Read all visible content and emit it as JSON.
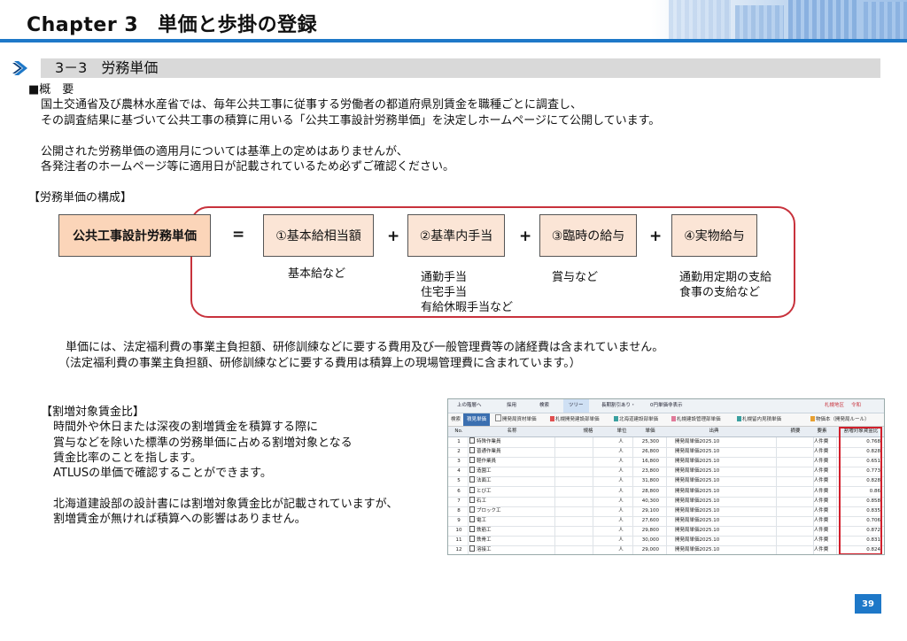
{
  "header": {
    "chapter": "Chapter 3",
    "title": "単価と歩掛の登録",
    "accent_color": "#1e78c8"
  },
  "section": {
    "title": "3－3　労務単価"
  },
  "overview": {
    "heading": "■概　要",
    "lines": [
      "国土交通省及び農林水産省では、毎年公共工事に従事する労働者の都道府県別賃金を職種ごとに調査し、",
      "その調査結果に基づいて公共工事の積算に用いる「公共工事設計労務単価」を決定しホームページにて公開しています。",
      "公開された労務単価の適用月については基準上の定めはありませんが、",
      "各発注者のホームページ等に適用日が記載されているため必ずご確認ください。"
    ]
  },
  "composition": {
    "heading": "【労務単価の構成】",
    "main_box": "公共工事設計労務単価",
    "equals": "=",
    "plus": "+",
    "boxes": [
      "①基本給相当額",
      "②基準内手当",
      "③臨時の給与",
      "④実物給与"
    ],
    "notes": {
      "b1": [
        "基本給など"
      ],
      "b2": [
        "通勤手当",
        "住宅手当",
        "有給休暇手当など"
      ],
      "b3": [
        "賞与など"
      ],
      "b4": [
        "通勤用定期の支給",
        "食事の支給など"
      ]
    },
    "footnote": [
      "単価には、法定福利費の事業主負担額、研修訓練などに要する費用及び一般管理費等の諸経費は含まれていません。",
      "（法定福利費の事業主負担額、研修訓練などに要する費用は積算上の現場管理費に含まれています。）"
    ]
  },
  "ratio": {
    "heading": "【割増対象賃金比】",
    "lines": [
      "時間外や休日または深夜の割増賃金を積算する際に",
      "賞与などを除いた標準の労務単価に占める割増対象となる",
      "賃金比率のことを指します。",
      "ATLUSの単価で確認することができます。",
      "北海道建設部の設計書には割増対象賃金比が記載されていますが、",
      "割増賃金が無ければ積算への影響はありません。"
    ]
  },
  "screenshot": {
    "toolbar": [
      "上の階層へ",
      "採用",
      "検索",
      "ツリー",
      "長期割引あり・",
      "0円単価非表示"
    ],
    "region": "札幌地区",
    "year": "令和",
    "tabs": [
      "検索",
      "積見単価",
      "開発局資材単価",
      "札幌開発建設部単価",
      "北海道建設部単価",
      "札幌建設管理部単価",
      "札幌留内見積単価",
      "物価本（開発局ルール）"
    ],
    "columns": [
      "No.",
      "名称",
      "規格",
      "単位",
      "単価",
      "出典",
      "摘要",
      "要素",
      "割増対象賃金比"
    ],
    "rows": [
      {
        "no": "1",
        "name": "特殊作業員",
        "unit": "人",
        "price": "25,300",
        "src": "開発局単価2025.10",
        "elem": "人件費",
        "ratio": "0.768"
      },
      {
        "no": "2",
        "name": "普通作業員",
        "unit": "人",
        "price": "26,800",
        "src": "開発局単価2025.10",
        "elem": "人件費",
        "ratio": "0.828"
      },
      {
        "no": "3",
        "name": "軽作業員",
        "unit": "人",
        "price": "16,800",
        "src": "開発局単価2025.10",
        "elem": "人件費",
        "ratio": "0.651"
      },
      {
        "no": "4",
        "name": "造園工",
        "unit": "人",
        "price": "23,800",
        "src": "開発局単価2025.10",
        "elem": "人件費",
        "ratio": "0.773"
      },
      {
        "no": "5",
        "name": "法面工",
        "unit": "人",
        "price": "31,800",
        "src": "開発局単価2025.10",
        "elem": "人件費",
        "ratio": "0.828"
      },
      {
        "no": "6",
        "name": "とび工",
        "unit": "人",
        "price": "28,800",
        "src": "開発局単価2025.10",
        "elem": "人件費",
        "ratio": "0.86"
      },
      {
        "no": "7",
        "name": "石工",
        "unit": "人",
        "price": "40,300",
        "src": "開発局単価2025.10",
        "elem": "人件費",
        "ratio": "0.858"
      },
      {
        "no": "8",
        "name": "ブロック工",
        "unit": "人",
        "price": "29,100",
        "src": "開発局単価2025.10",
        "elem": "人件費",
        "ratio": "0.835"
      },
      {
        "no": "9",
        "name": "電工",
        "unit": "人",
        "price": "27,600",
        "src": "開発局単価2025.10",
        "elem": "人件費",
        "ratio": "0.706"
      },
      {
        "no": "10",
        "name": "鉄筋工",
        "unit": "人",
        "price": "29,800",
        "src": "開発局単価2025.10",
        "elem": "人件費",
        "ratio": "0.872"
      },
      {
        "no": "11",
        "name": "鉄骨工",
        "unit": "人",
        "price": "30,000",
        "src": "開発局単価2025.10",
        "elem": "人件費",
        "ratio": "0.831"
      },
      {
        "no": "12",
        "name": "溶接工",
        "unit": "人",
        "price": "29,000",
        "src": "開発局単価2025.10",
        "elem": "人件費",
        "ratio": "0.824"
      }
    ]
  },
  "page_number": "39"
}
